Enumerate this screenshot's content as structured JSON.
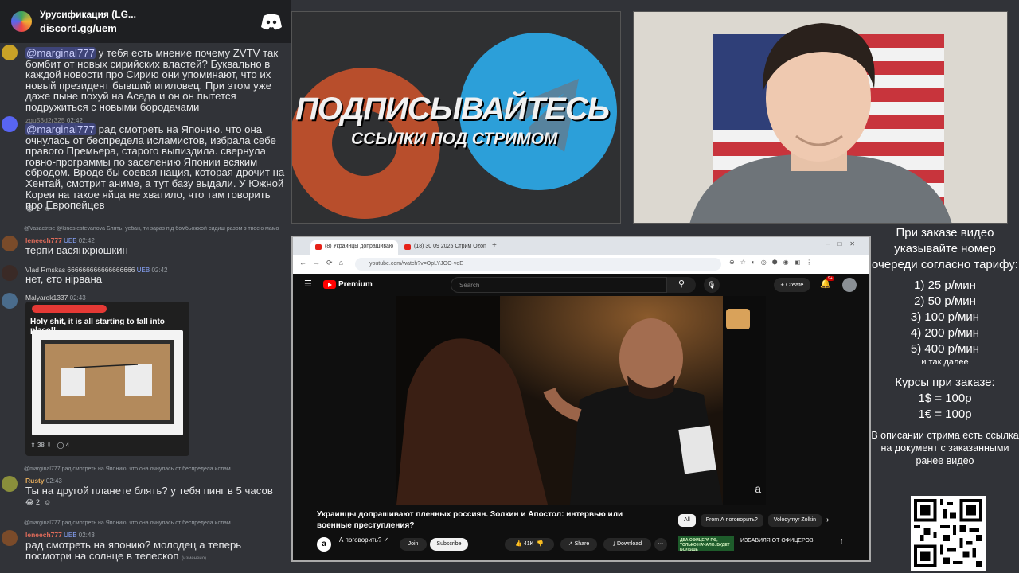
{
  "discord": {
    "server_name": "Урусификация (LG...",
    "invite_link": "discord.gg/uem",
    "messages": [
      {
        "mention": "@marginal777",
        "text": " у тебя есть мнение почему ZVTV так бомбит от новых сирийских властей? Буквально в каждой новости про Сирию они упоминают, что их новый президент бывший игиловец. При этом уже даже пыне похуй на Асада и он он пытется подружиться с новыми бородачами"
      },
      {
        "username": "zgu53d2r325",
        "time": "02:42",
        "mention": "@marginal777",
        "text": " рад смотреть на Японию. что она очнулась от беспредела исламистов, избрала себе правого Премьера, старого выпиздила. свернула говно-программы по заселению Японии всяким сбродом. Вроде бы соевая нация, которая дрочит на Хентай, смотрит аниме, а тут базу выдали. У Южной Кореи на такое яйца не хватило, что там говорить про Европейцев",
        "reactions": "1"
      },
      {
        "reply": "@Vasactrise @kinosiestevanova Блять, уебан, ти зараз під бомбьожкой сидиш разом з твоєю мамо",
        "username": "leneech777",
        "badge": "UEB",
        "time": "02:42",
        "text": "терпи васянхрюшкин"
      },
      {
        "username": "Vlad Rmskas 666666666666666666",
        "badge": "UEB",
        "time": "02:42",
        "text": "нет, єто нірвана"
      },
      {
        "username": "Malyarok1337",
        "time": "02:43",
        "embed_title": "Holy shit, it is all starting to fall into place!!",
        "embed_votes": "38",
        "embed_comments": "4"
      },
      {
        "reply": "@marginal777 рад смотреть на Японию. что она очнулась от беспредела ислам...",
        "username": "Rusty",
        "time": "02:43",
        "text": "Ты на другой планете блять? у тебя пинг в 5 часов",
        "reactions": "2"
      },
      {
        "reply": "@marginal777 рад смотреть на Японию. что она очнулась от беспредела ислам...",
        "username": "leneech777",
        "badge": "UEB",
        "time": "02:43",
        "text": "рад смотреть на японию? молодец а теперь посмотри на солнце в телескоп",
        "edited": "(изменено)"
      }
    ]
  },
  "banner": {
    "title": "ПОДПИСЫВАЙТЕСЬ",
    "subtitle": "ССЫЛКИ ПОД СТРИМОМ"
  },
  "browser": {
    "tabs": [
      "(8) Украинцы допрашиваю",
      "(18) 30 09 2025 Стрим Ozon"
    ],
    "url": "youtube.com/watch?v=OpLYJOO-voE"
  },
  "youtube": {
    "brand": "Premium",
    "search_placeholder": "Search",
    "create_label": "Create",
    "notifications": "9+",
    "video_title": "Украинцы допрашивают пленных россиян. Золкин и Апостол: интервью или военные преступления?",
    "channel_name": "А поговорить? ✓",
    "join_label": "Join",
    "subscribe_label": "Subscribe",
    "likes": "41K",
    "share_label": "Share",
    "download_label": "Download",
    "chips": [
      "All",
      "From А поговорить?",
      "Volodymyr Zolkin"
    ],
    "rec_title": "ИЗБАВИЛЯ ОТ ОФИЦЕРОВ",
    "rec_thumb_text": "ДВА ОФИЦЕРА РФ, ТОЛЬКО НАЧАЛО. БУДЕТ БОЛЬШЕ"
  },
  "info_panel": {
    "intro": "При заказе видео указывайте номер очереди согласно тарифу:",
    "prices": [
      "1) 25 р/мин",
      "2) 50 р/мин",
      "3) 100 р/мин",
      "4) 200 р/мин",
      "5) 400 р/мин"
    ],
    "and_so_on": "и так далее",
    "courses_title": "Курсы при заказе:",
    "rates": [
      "1$ = 100р",
      "1€ = 100р"
    ],
    "description": "В описании стрима есть ссылка на документ с заказанными ранее видео"
  }
}
